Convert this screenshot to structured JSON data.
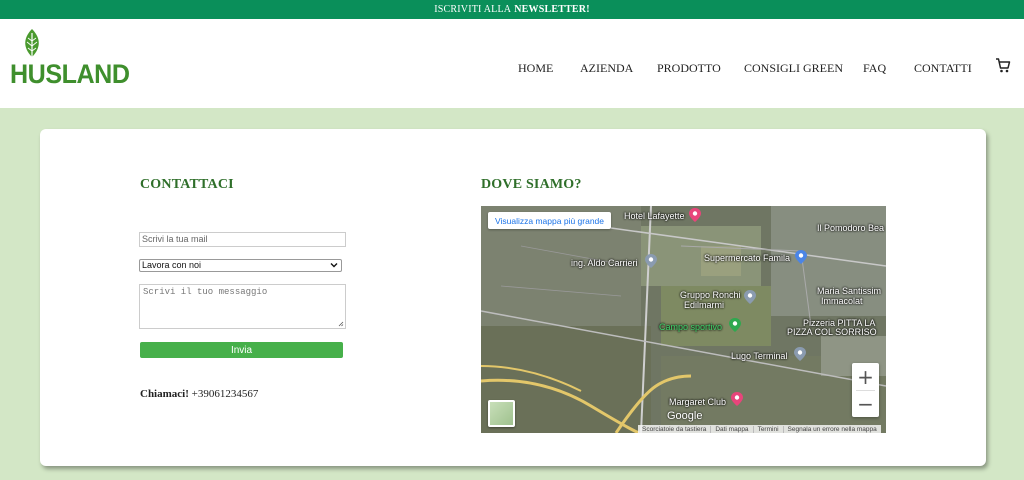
{
  "topbar": {
    "prefix": "ISCRIVITI ALLA",
    "bold": "NEWSLETTER!"
  },
  "brand": {
    "name": "HUSLAND",
    "color": "#3f8f2d"
  },
  "nav": {
    "items": [
      "HOME",
      "AZIENDA",
      "PRODOTTO",
      "CONSIGLI GREEN",
      "FAQ",
      "CONTATTI"
    ],
    "cart_icon": "cart-icon"
  },
  "contact": {
    "title": "CONTATTACI",
    "email_placeholder": "Scrivi la tua mail",
    "select_value": "Lavora con noi",
    "message_placeholder": "Scrivi il tuo messaggio",
    "submit_label": "Invia",
    "call_label": "Chiamaci!",
    "phone": "+39061234567"
  },
  "location": {
    "title": "DOVE SIAMO?",
    "map_link": "Visualizza mappa più grande",
    "labels": {
      "hotel": "Hotel Lafayette",
      "pomodoro": "Il Pomodoro Bea",
      "aldo": "ing. Aldo Carrieri",
      "supermercato": "Supermercato Famila",
      "gruppo1": "Gruppo Ronchi",
      "gruppo2": "Edilmarmi",
      "maria1": "Maria Santissim",
      "maria2": "Immacolat",
      "campo": "Campo sportivo",
      "pizzeria1": "Pizzeria PITTA LA",
      "pizzeria2": "PIZZA COL SORRISO",
      "lugo": "Lugo Terminal",
      "margaret": "Margaret Club"
    },
    "zoom_in": "+",
    "zoom_out": "−",
    "google": "Google",
    "attribution": [
      "Scorciatoie da tastiera",
      "Dati mappa",
      "Termini",
      "Segnala un errore nella mappa"
    ]
  },
  "colors": {
    "topbar": "#0a8f5a",
    "heading": "#2f6f2a",
    "button": "#46b04a",
    "page_bg": "#d3e7c6"
  }
}
